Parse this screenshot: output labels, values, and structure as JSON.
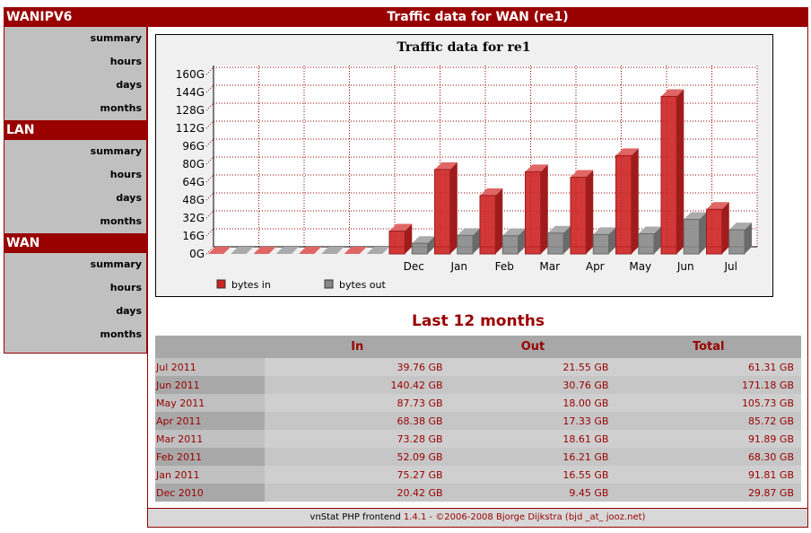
{
  "sidebar": [
    {
      "title": "WANIPV6",
      "items": [
        "summary",
        "hours",
        "days",
        "months"
      ]
    },
    {
      "title": "LAN",
      "items": [
        "summary",
        "hours",
        "days",
        "months"
      ]
    },
    {
      "title": "WAN",
      "items": [
        "summary",
        "hours",
        "days",
        "months"
      ]
    }
  ],
  "header": {
    "title": "Traffic data for WAN (re1)"
  },
  "chart_data": {
    "type": "bar",
    "title": "Traffic data for re1",
    "categories": [
      "",
      "",
      "",
      "",
      "Dec",
      "Jan",
      "Feb",
      "Mar",
      "Apr",
      "May",
      "Jun",
      "Jul"
    ],
    "series": [
      {
        "name": "bytes in",
        "color": "#cc2222",
        "values": [
          0,
          0,
          0,
          0,
          20.42,
          75.27,
          52.09,
          73.28,
          68.38,
          87.73,
          140.42,
          39.76
        ]
      },
      {
        "name": "bytes out",
        "color": "#888888",
        "values": [
          0,
          0,
          0,
          0,
          9.45,
          16.55,
          16.21,
          18.61,
          17.33,
          18.0,
          30.76,
          21.55
        ]
      }
    ],
    "yticks": [
      "0G",
      "16G",
      "32G",
      "48G",
      "64G",
      "80G",
      "96G",
      "112G",
      "128G",
      "144G",
      "160G"
    ],
    "ylim": [
      0,
      176
    ],
    "grid": true,
    "legend": "bottom-left"
  },
  "table": {
    "caption": "Last 12 months",
    "headers": [
      "",
      "In",
      "Out",
      "Total"
    ],
    "rows": [
      [
        "Jul 2011",
        "39.76 GB",
        "21.55 GB",
        "61.31 GB"
      ],
      [
        "Jun 2011",
        "140.42 GB",
        "30.76 GB",
        "171.18 GB"
      ],
      [
        "May 2011",
        "87.73 GB",
        "18.00 GB",
        "105.73 GB"
      ],
      [
        "Apr 2011",
        "68.38 GB",
        "17.33 GB",
        "85.72 GB"
      ],
      [
        "Mar 2011",
        "73.28 GB",
        "18.61 GB",
        "91.89 GB"
      ],
      [
        "Feb 2011",
        "52.09 GB",
        "16.21 GB",
        "68.30 GB"
      ],
      [
        "Jan 2011",
        "75.27 GB",
        "16.55 GB",
        "91.81 GB"
      ],
      [
        "Dec 2010",
        "20.42 GB",
        "9.45 GB",
        "29.87 GB"
      ]
    ]
  },
  "footer": {
    "prefix": "vnStat PHP frontend ",
    "version": "1.4.1 - ©2006-2008 Bjorge Dijkstra (bjd _at_ jooz.net)"
  }
}
